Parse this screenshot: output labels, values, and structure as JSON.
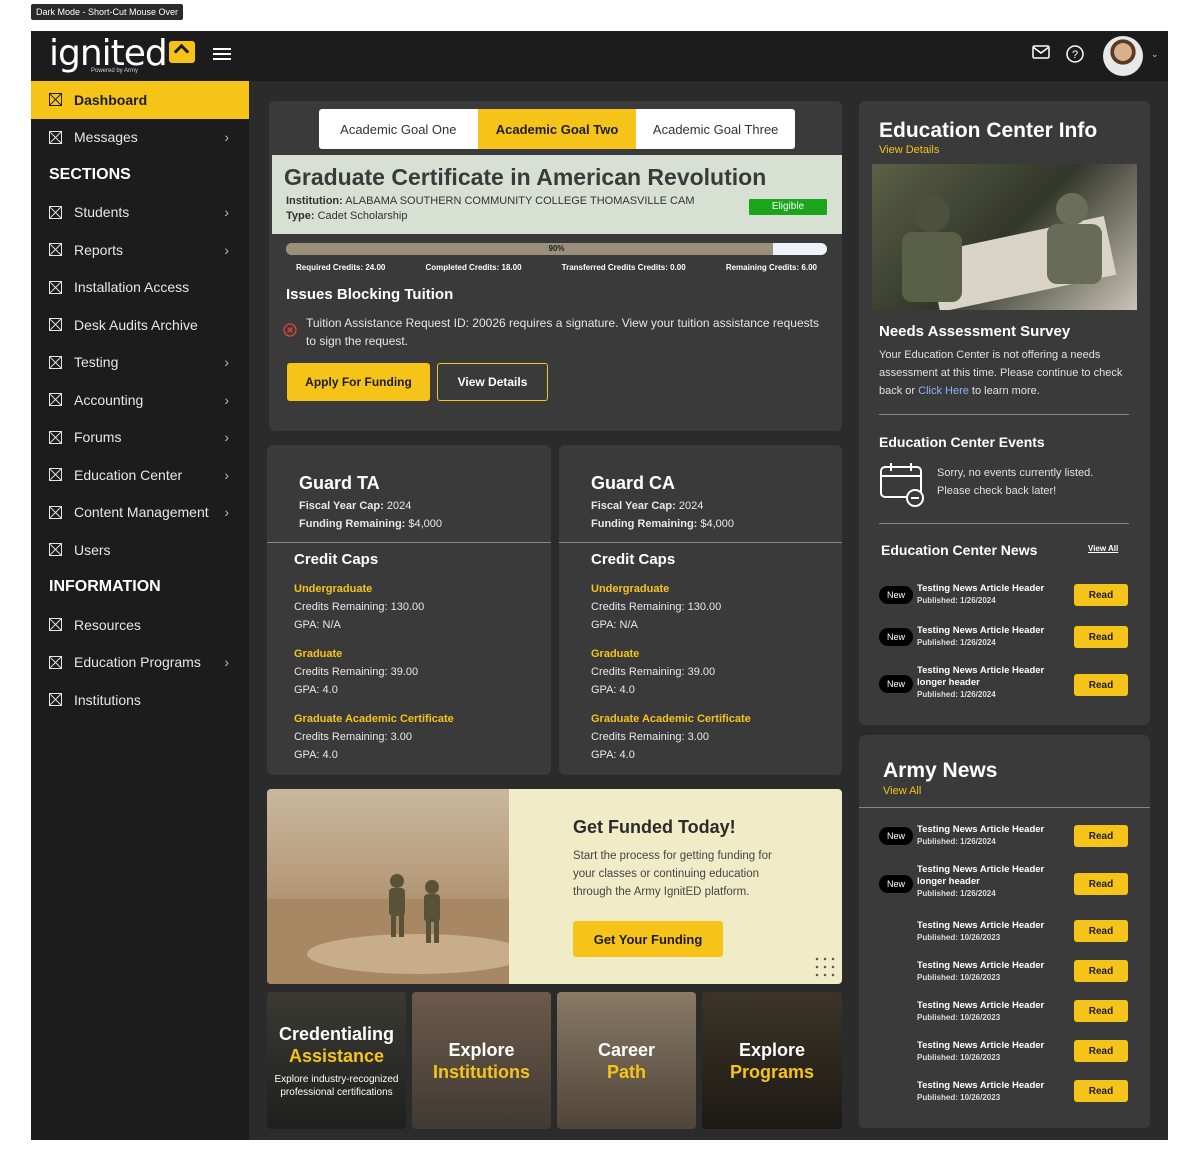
{
  "frame_label": "Dark Mode - Short-Cut Mouse Over",
  "brand": {
    "name": "ignited",
    "sub": "Powered by Army"
  },
  "sidebar": {
    "items": [
      {
        "label": "Dashboard"
      },
      {
        "label": "Messages"
      },
      {
        "label": "SECTIONS"
      },
      {
        "label": "Students"
      },
      {
        "label": "Reports"
      },
      {
        "label": "Installation Access"
      },
      {
        "label": "Desk Audits Archive"
      },
      {
        "label": "Testing"
      },
      {
        "label": "Accounting"
      },
      {
        "label": "Forums"
      },
      {
        "label": "Education Center"
      },
      {
        "label": "Content Management"
      },
      {
        "label": "Users"
      },
      {
        "label": "INFORMATION"
      },
      {
        "label": "Resources"
      },
      {
        "label": "Education Programs"
      },
      {
        "label": "Institutions"
      }
    ]
  },
  "goals": {
    "tabs": [
      "Academic Goal One",
      "Academic Goal Two",
      "Academic Goal Three"
    ],
    "active_tab": 1,
    "title": "Graduate Certificate in American Revolution",
    "institution_label": "Institution:",
    "institution": "ALABAMA SOUTHERN COMMUNITY COLLEGE THOMASVILLE CAM",
    "type_label": "Type:",
    "type": "Cadet Scholarship",
    "status": "Eligible",
    "progress": 0.9,
    "progress_label": "90%",
    "credits": {
      "required": "Required Credits: 24.00",
      "completed": "Completed Credits: 18.00",
      "transferred": "Transferred Credits Credits: 0.00",
      "remaining": "Remaining Credits: 6.00"
    },
    "issues_title": "Issues Blocking Tuition",
    "issue_text": "Tuition Assistance Request ID: 20026 requires a signature. View your tuition assistance requests to sign the request.",
    "apply_button": "Apply For Funding",
    "details_button": "View Details"
  },
  "funding_cards": [
    {
      "title": "Guard TA",
      "cap_label": "Fiscal Year Cap:",
      "cap": "2024",
      "remaining_label": "Funding Remaining:",
      "remaining": "$4,000",
      "caps_title": "Credit Caps",
      "groups": [
        {
          "name": "Undergraduate",
          "credits": "Credits Remaining: 130.00",
          "gpa": "GPA: N/A"
        },
        {
          "name": "Graduate",
          "credits": "Credits Remaining: 39.00",
          "gpa": "GPA: 4.0"
        },
        {
          "name": "Graduate Academic Certificate",
          "credits": "Credits Remaining: 3.00",
          "gpa": "GPA: 4.0"
        }
      ]
    },
    {
      "title": "Guard CA",
      "cap_label": "Fiscal Year Cap:",
      "cap": "2024",
      "remaining_label": "Funding Remaining:",
      "remaining": "$4,000",
      "caps_title": "Credit Caps",
      "groups": [
        {
          "name": "Undergraduate",
          "credits": "Credits Remaining: 130.00",
          "gpa": "GPA: N/A"
        },
        {
          "name": "Graduate",
          "credits": "Credits Remaining: 39.00",
          "gpa": "GPA: 4.0"
        },
        {
          "name": "Graduate Academic Certificate",
          "credits": "Credits Remaining: 3.00",
          "gpa": "GPA: 4.0"
        }
      ]
    }
  ],
  "promo": {
    "title": "Get Funded Today!",
    "text": "Start the process for getting funding for your classes or continuing education through the Army IgnitED platform.",
    "button": "Get Your Funding"
  },
  "tiles": [
    {
      "line1": "Credentialing",
      "line2": "Assistance",
      "desc": "Explore industry-recognized professional certifications"
    },
    {
      "line1": "Explore",
      "line2": "Institutions",
      "desc": ""
    },
    {
      "line1": "Career",
      "line2": "Path",
      "desc": ""
    },
    {
      "line1": "Explore",
      "line2": "Programs",
      "desc": ""
    }
  ],
  "edu_center": {
    "title": "Education Center Info",
    "view_details": "View Details",
    "survey_title": "Needs Assessment Survey",
    "survey_text_1": "Your Education Center is not offering a needs assessment at this time. Please continue to check back or ",
    "survey_link": "Click Here",
    "survey_text_2": " to learn more.",
    "events_title": "Education Center Events",
    "events_text": "Sorry, no events currently listed. Please check back later!",
    "news_title": "Education Center News",
    "view_all": "View All",
    "news": [
      {
        "badge": "New",
        "title": "Testing News Article Header",
        "published": "Published: 1/26/2024",
        "button": "Read"
      },
      {
        "badge": "New",
        "title": "Testing News Article Header",
        "published": "Published: 1/26/2024",
        "button": "Read"
      },
      {
        "badge": "New",
        "title": "Testing News Article Header longer header",
        "published": "Published: 1/26/2024",
        "button": "Read"
      }
    ]
  },
  "army_news": {
    "title": "Army News",
    "view_all": "View All",
    "news": [
      {
        "badge": "New",
        "title": "Testing News Article Header",
        "published": "Published: 1/26/2024",
        "button": "Read"
      },
      {
        "badge": "New",
        "title": "Testing News Article Header longer header",
        "published": "Published: 1/26/2024",
        "button": "Read"
      },
      {
        "badge": "",
        "title": "Testing News Article Header",
        "published": "Published: 10/26/2023",
        "button": "Read"
      },
      {
        "badge": "",
        "title": "Testing News Article Header",
        "published": "Published: 10/26/2023",
        "button": "Read"
      },
      {
        "badge": "",
        "title": "Testing News Article Header",
        "published": "Published: 10/26/2023",
        "button": "Read"
      },
      {
        "badge": "",
        "title": "Testing News Article Header",
        "published": "Published: 10/26/2023",
        "button": "Read"
      },
      {
        "badge": "",
        "title": "Testing News Article Header",
        "published": "Published: 10/26/2023",
        "button": "Read"
      }
    ]
  },
  "colors": {
    "accent": "#f6c419",
    "bg": "#2b2b2b",
    "panel": "#3a3a3a",
    "sidebar": "#1c1c1c",
    "eligible": "#1aa51a"
  },
  "icons": [
    "hamburger-icon",
    "mail-icon",
    "help-icon",
    "chevron-down-icon",
    "chevron-right-icon",
    "placeholder-x-icon",
    "error-circle-icon",
    "calendar-icon"
  ]
}
